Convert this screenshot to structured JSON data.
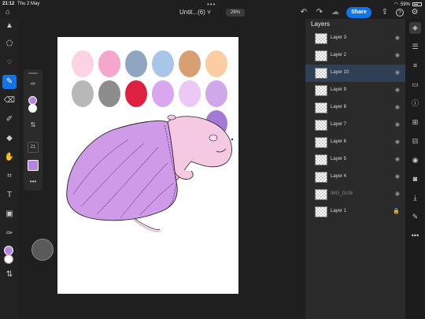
{
  "status": {
    "time": "21:12",
    "date": "Thu 2 May",
    "battery": "59%",
    "dots": "•••"
  },
  "topbar": {
    "title": "Untit...(6)",
    "title_chevron": "˅",
    "zoom": "26%",
    "share_label": "Share",
    "undo_icon": "↶",
    "redo_icon": "↷",
    "cloud_icon": "☁",
    "export_icon": "⇪",
    "help_icon": "?",
    "settings_icon": "⚙"
  },
  "left_tools": [
    {
      "name": "select-tool",
      "glyph": "▲"
    },
    {
      "name": "transform-tool",
      "glyph": "⬠"
    },
    {
      "name": "lasso-tool",
      "glyph": "◌"
    },
    {
      "name": "brush-tool",
      "glyph": "✎"
    },
    {
      "name": "eraser-tool",
      "glyph": "⌫"
    },
    {
      "name": "mixer-brush-tool",
      "glyph": "✐"
    },
    {
      "name": "fill-tool",
      "glyph": "◆"
    },
    {
      "name": "smudge-tool",
      "glyph": "✋"
    },
    {
      "name": "crop-tool",
      "glyph": "⌗"
    },
    {
      "name": "text-tool",
      "glyph": "T"
    },
    {
      "name": "image-tool",
      "glyph": "▣"
    },
    {
      "name": "eyedropper-tool",
      "glyph": "✑"
    },
    {
      "name": "swap-colors",
      "glyph": "⇅"
    }
  ],
  "brush_panel": {
    "size_value": "21",
    "more_label": "•••",
    "eyedropper_glyph": "✑",
    "swap_glyph": "⇅"
  },
  "colors": {
    "foreground": "#b784e0",
    "background": "#ffffff",
    "accent": "#1473e6"
  },
  "palette": [
    {
      "color": "#fbd3e3"
    },
    {
      "color": "#f6a6cc"
    },
    {
      "color": "#8fa6c0"
    },
    {
      "color": "#a9c6e8"
    },
    {
      "color": "#d8a070"
    },
    {
      "color": "#fccca2"
    },
    {
      "color": "#b8b8b8"
    },
    {
      "color": "#8d8d8d"
    },
    {
      "color": "#e02040"
    },
    {
      "color": "#d9a6f0"
    },
    {
      "color": "#ebc9f6"
    },
    {
      "color": "#cea8e8"
    },
    {
      "color": "#a57ad6"
    }
  ],
  "layers": {
    "title": "Layers",
    "items": [
      {
        "name": "Layer 3",
        "selected": false,
        "dim": false,
        "locked": false
      },
      {
        "name": "Layer 2",
        "selected": false,
        "dim": false,
        "locked": false
      },
      {
        "name": "Layer 10",
        "selected": true,
        "dim": false,
        "locked": false
      },
      {
        "name": "Layer 9",
        "selected": false,
        "dim": false,
        "locked": false
      },
      {
        "name": "Layer 8",
        "selected": false,
        "dim": false,
        "locked": false
      },
      {
        "name": "Layer 7",
        "selected": false,
        "dim": false,
        "locked": false
      },
      {
        "name": "Layer 6",
        "selected": false,
        "dim": false,
        "locked": false
      },
      {
        "name": "Layer 5",
        "selected": false,
        "dim": false,
        "locked": false
      },
      {
        "name": "Layer 4",
        "selected": false,
        "dim": false,
        "locked": false
      },
      {
        "name": "IMG_0108",
        "selected": false,
        "dim": true,
        "locked": false
      },
      {
        "name": "Layer 1",
        "selected": false,
        "dim": false,
        "locked": true
      }
    ]
  },
  "right_strip": [
    {
      "name": "layers-panel-icon",
      "glyph": "◈"
    },
    {
      "name": "layer-properties-icon",
      "glyph": "☰"
    },
    {
      "name": "adjustments-icon",
      "glyph": "≡"
    },
    {
      "name": "comments-icon",
      "glyph": "▭"
    },
    {
      "name": "info-icon",
      "glyph": "ⓘ"
    },
    {
      "name": "add-layer-icon",
      "glyph": "⊞"
    },
    {
      "name": "group-icon",
      "glyph": "⊟"
    },
    {
      "name": "visibility-icon",
      "glyph": "◉"
    },
    {
      "name": "mask-icon",
      "glyph": "◙"
    },
    {
      "name": "merge-icon",
      "glyph": "⤓"
    },
    {
      "name": "clear-icon",
      "glyph": "✎"
    },
    {
      "name": "more-icon",
      "glyph": "•••"
    }
  ]
}
